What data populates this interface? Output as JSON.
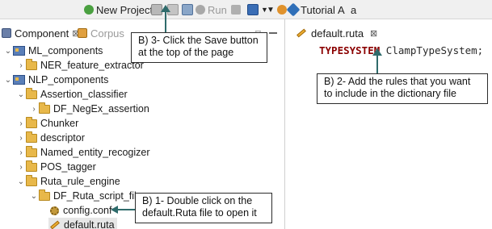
{
  "toolbar": {
    "new_project": "New Project",
    "run": "Run",
    "tutorial": "Tutorial",
    "letter_a_upper": "A",
    "letter_a_lower": "a"
  },
  "left_panel": {
    "tabs": [
      {
        "label": "Component",
        "close": "⊠"
      },
      {
        "label": "Corpus"
      }
    ],
    "tree": [
      {
        "label": "ML_components",
        "expanded": true
      },
      {
        "label": "NER_feature_extractor",
        "expanded": false
      },
      {
        "label": "NLP_components",
        "expanded": true
      },
      {
        "label": "Assertion_classifier",
        "expanded": true
      },
      {
        "label": "DF_NegEx_assertion",
        "expanded": false
      },
      {
        "label": "Chunker",
        "expanded": false
      },
      {
        "label": "descriptor",
        "expanded": false
      },
      {
        "label": "Named_entity_recogizer",
        "expanded": false
      },
      {
        "label": "POS_tagger",
        "expanded": false
      },
      {
        "label": "Ruta_rule_engine",
        "expanded": true
      },
      {
        "label": "DF_Ruta_script_file",
        "expanded": true
      },
      {
        "label": "config.conf"
      },
      {
        "label": "default.ruta",
        "selected": true
      }
    ]
  },
  "editor": {
    "tab_label": "default.ruta",
    "tab_close": "⊠",
    "keyword": "TYPESYSTEM",
    "code_rest": " ClampTypeSystem;"
  },
  "callouts": {
    "save": [
      "B) 3- Click the Save button",
      "at the top of the page"
    ],
    "rules": [
      "B) 2- Add the rules that you want",
      "to include in the dictionary file"
    ],
    "open": [
      "B) 1- Double click on the",
      "default.Ruta file to open it"
    ]
  },
  "colors": {
    "keyword": "#8b0000",
    "arrow": "#2f6b6b",
    "folder": "#e8b84a"
  }
}
